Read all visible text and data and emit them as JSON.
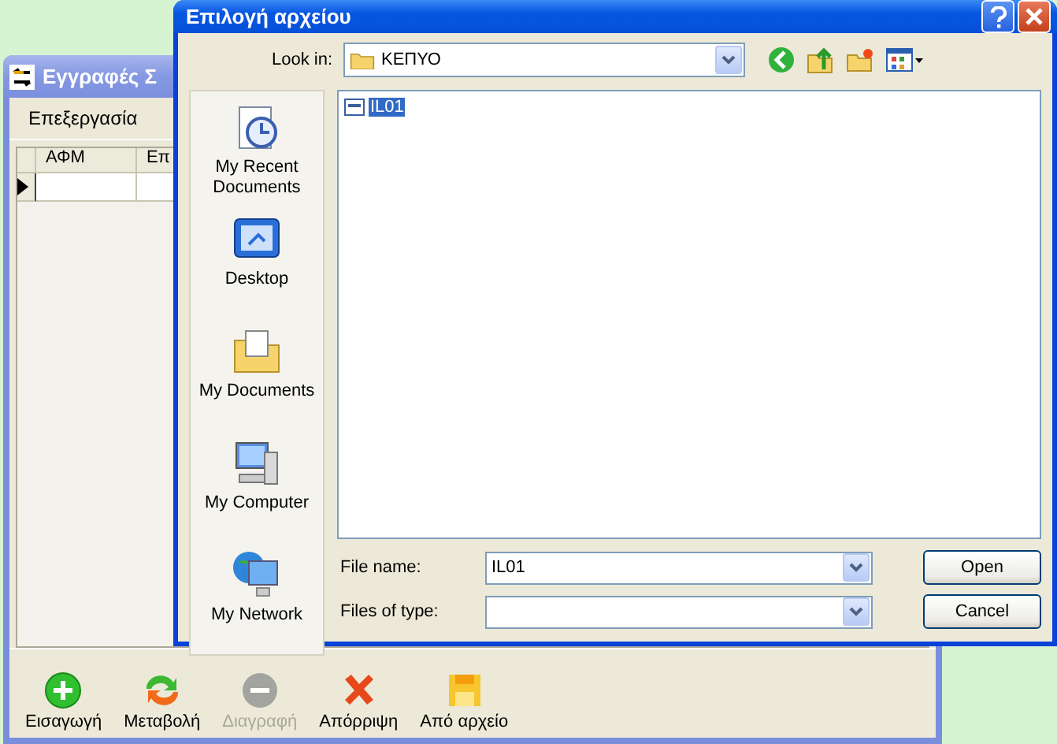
{
  "back_window": {
    "title": "Εγγραφές Σ",
    "menu": [
      "Επεξεργασία"
    ],
    "table": {
      "columns": [
        "ΑΦΜ",
        "Επ"
      ],
      "rows": [
        {
          "current": true
        }
      ]
    },
    "toolbar": [
      {
        "kind": "add",
        "label": "Εισαγωγή",
        "disabled": false
      },
      {
        "kind": "edit",
        "label": "Μεταβολή",
        "disabled": false
      },
      {
        "kind": "delete",
        "label": "Διαγραφή",
        "disabled": true
      },
      {
        "kind": "cancel",
        "label": "Απόρριψη",
        "disabled": false
      },
      {
        "kind": "file",
        "label": "Από αρχείο",
        "disabled": false
      }
    ]
  },
  "dialog": {
    "title": "Επιλογή αρχείου",
    "look_in": {
      "label": "Look in:",
      "value": "ΚΕΠΥΟ"
    },
    "places": [
      {
        "kind": "recent",
        "label": "My Recent Documents"
      },
      {
        "kind": "desktop",
        "label": "Desktop"
      },
      {
        "kind": "documents",
        "label": "My Documents"
      },
      {
        "kind": "computer",
        "label": "My Computer"
      },
      {
        "kind": "network",
        "label": "My Network"
      }
    ],
    "files": [
      {
        "name": "IL01",
        "selected": true
      }
    ],
    "file_name": {
      "label": "File name:",
      "value": "IL01"
    },
    "file_type": {
      "label": "Files of type:"
    },
    "buttons": [
      "Open",
      "Cancel"
    ]
  }
}
